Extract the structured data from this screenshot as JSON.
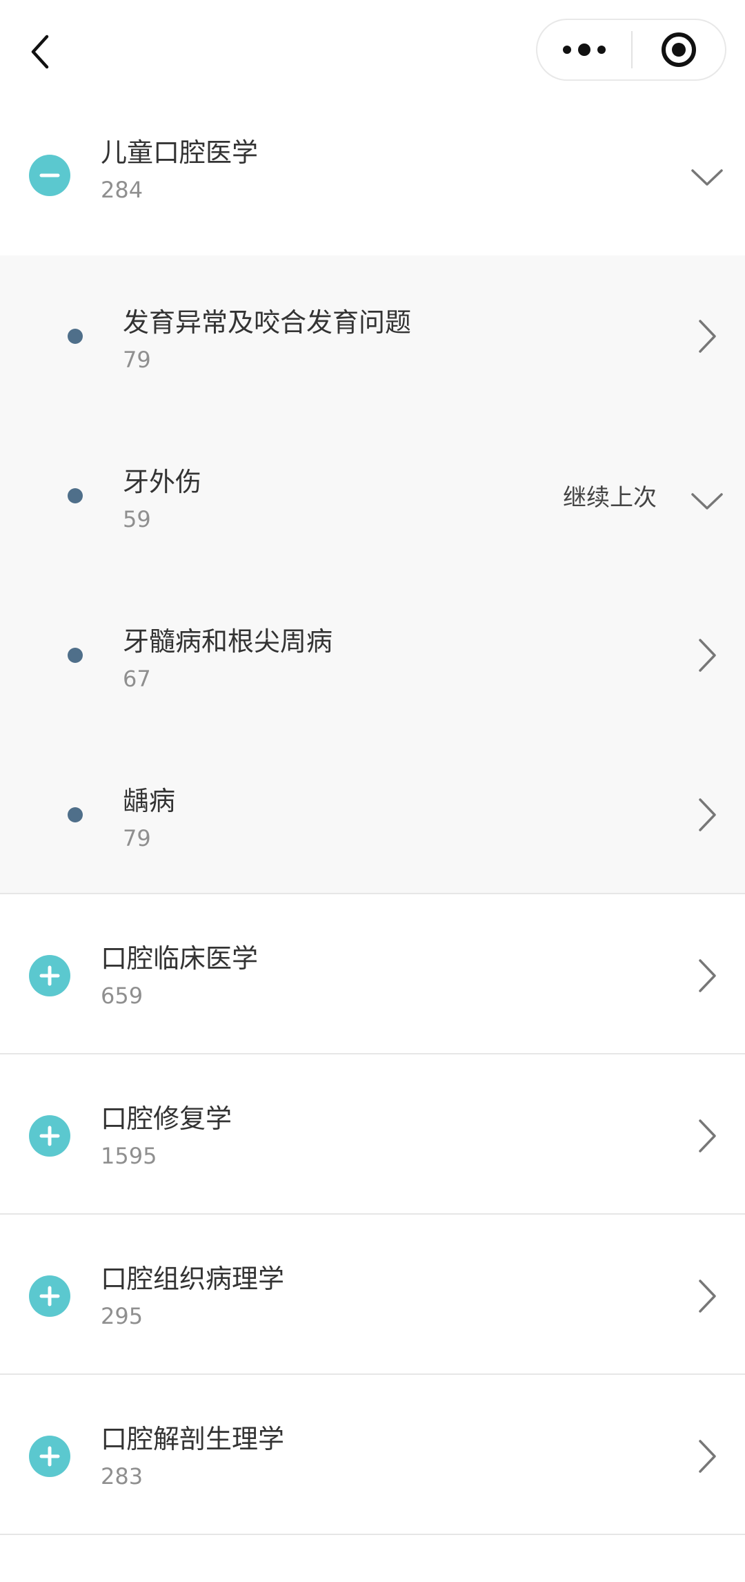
{
  "nav": {
    "back_icon": "chevron-left-icon",
    "more_icon": "more-dots-icon",
    "close_icon": "target-circle-icon"
  },
  "accent_color": "#5bc8cf",
  "dot_color": "#4f6f8a",
  "expanded_category": {
    "title": "儿童口腔医学",
    "count": "284",
    "subcategories": [
      {
        "title": "发育异常及咬合发育问题",
        "count": "79"
      },
      {
        "title": "牙外伤",
        "count": "59",
        "continue_label": "继续上次"
      },
      {
        "title": "牙髓病和根尖周病",
        "count": "67"
      },
      {
        "title": "龋病",
        "count": "79"
      }
    ]
  },
  "categories": [
    {
      "title": "口腔临床医学",
      "count": "659"
    },
    {
      "title": "口腔修复学",
      "count": "1595"
    },
    {
      "title": "口腔组织病理学",
      "count": "295"
    },
    {
      "title": "口腔解剖生理学",
      "count": "283"
    }
  ]
}
